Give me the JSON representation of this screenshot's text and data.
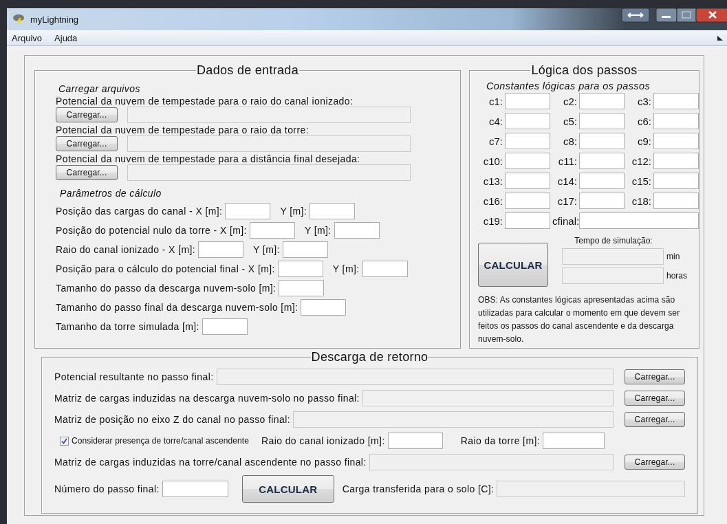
{
  "window": {
    "title": "myLightning"
  },
  "menu": [
    "Arquivo",
    "Ajuda"
  ],
  "dados_de_entrada": {
    "title": "Dados de entrada",
    "files_heading": "Carregar arquivos",
    "files": [
      {
        "label": "Potencial da nuvem de tempestade para o raio do canal ionizado:",
        "button": "Carregar..."
      },
      {
        "label": "Potencial da nuvem de tempestade para o raio da torre:",
        "button": "Carregar..."
      },
      {
        "label": "Potencial da nuvem de tempestade para a distância final desejada:",
        "button": "Carregar..."
      }
    ],
    "params_heading": "Parâmetros de cálculo",
    "params": [
      {
        "label": "Posição das cargas do canal - X [m]:",
        "y_label": "Y [m]:"
      },
      {
        "label": "Posição do potencial nulo da torre - X [m]:",
        "y_label": "Y [m]:"
      },
      {
        "label": "Raio do canal ionizado - X [m]:",
        "y_label": "Y [m]:"
      },
      {
        "label": "Posição para o cálculo do potencial final - X [m]:",
        "y_label": "Y [m]:"
      },
      {
        "label": "Tamanho do passo da descarga nuvem-solo [m]:"
      },
      {
        "label": "Tamanho do passo final da descarga nuvem-solo [m]:"
      },
      {
        "label": "Tamanho da torre simulada [m]:"
      }
    ]
  },
  "logica_dos_passos": {
    "title": "Lógica dos passos",
    "subtitle": "Constantes lógicas para os passos",
    "constants": [
      "c1:",
      "c2:",
      "c3:",
      "c4:",
      "c5:",
      "c6:",
      "c7:",
      "c8:",
      "c9:",
      "c10:",
      "c11:",
      "c12:",
      "c13:",
      "c14:",
      "c15:",
      "c16:",
      "c17:",
      "c18:",
      "c19:",
      "cfinal:"
    ],
    "time_label": "Tempo de simulação:",
    "units": [
      "min",
      "horas"
    ],
    "button": "CALCULAR",
    "note": "OBS: As constantes lógicas apresentadas acima são utilizadas para calcular o momento em que devem ser feitos os passos do canal ascendente e da descarga nuvem-solo."
  },
  "descarga_de_retorno": {
    "title": "Descarga de retorno",
    "rows": [
      {
        "kind": "file",
        "label": "Potencial resultante no passo final:",
        "button": "Carregar..."
      },
      {
        "kind": "file",
        "label": "Matriz de cargas induzidas na descarga nuvem-solo no passo final:",
        "button": "Carregar..."
      },
      {
        "kind": "file",
        "label": "Matriz de posição no eixo Z do canal no passo final:",
        "button": "Carregar..."
      },
      {
        "kind": "check",
        "label": "Considerar presença de torre/canal ascendente",
        "checked": true,
        "fields": [
          "Raio do canal ionizado [m]:",
          "Raio da torre [m]:"
        ]
      },
      {
        "kind": "file",
        "label": "Matriz de cargas induzidas na torre/canal ascendente no passo final:",
        "button": "Carregar..."
      },
      {
        "kind": "result",
        "label": "Número do passo final:",
        "button": "CALCULAR",
        "output_label": "Carga transferida para o solo [C]:"
      }
    ]
  }
}
